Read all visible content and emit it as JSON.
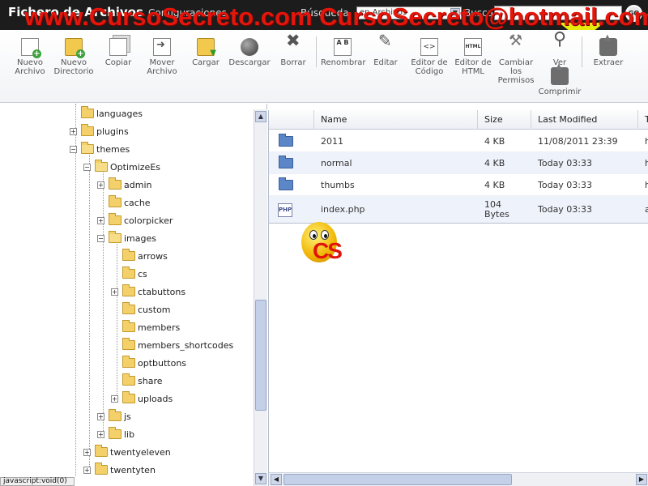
{
  "header": {
    "title": "Fichero de Archivos",
    "menu_config": "Configuraciones",
    "search_label": "Búsqueda",
    "search_scope": "en Archivos",
    "search_in": "Buscar",
    "search_value": "",
    "go_label": "GO"
  },
  "watermark": "www.CursoSecreto.com CursoSecreto@hotmail.com",
  "toolbar": [
    {
      "id": "nuevo-archivo",
      "label": "Nuevo Archivo",
      "icon": "new-file-icon"
    },
    {
      "id": "nuevo-directorio",
      "label": "Nuevo Directorio",
      "icon": "new-folder-icon"
    },
    {
      "id": "copiar",
      "label": "Copiar",
      "icon": "copy-icon"
    },
    {
      "id": "mover-archivo",
      "label": "Mover Archivo",
      "icon": "move-icon"
    },
    {
      "id": "cargar",
      "label": "Cargar",
      "icon": "upload-icon"
    },
    {
      "id": "descargar",
      "label": "Descargar",
      "icon": "download-icon"
    },
    {
      "id": "borrar",
      "label": "Borrar",
      "icon": "delete-icon"
    },
    {
      "id": "renombrar",
      "label": "Renombrar",
      "icon": "rename-icon"
    },
    {
      "id": "editar",
      "label": "Editar",
      "icon": "edit-icon"
    },
    {
      "id": "editor-codigo",
      "label": "Editor de Código",
      "icon": "code-editor-icon"
    },
    {
      "id": "editor-html",
      "label": "Editor de HTML",
      "icon": "html-editor-icon"
    },
    {
      "id": "cambiar-permisos",
      "label": "Cambiar los Permisos",
      "icon": "permissions-icon"
    },
    {
      "id": "ver",
      "label": "Ver",
      "icon": "view-icon"
    },
    {
      "id": "extraer",
      "label": "Extraer",
      "icon": "extract-icon"
    },
    {
      "id": "comprimir",
      "label": "Comprimir",
      "icon": "compress-icon"
    }
  ],
  "tree": [
    {
      "label": "languages",
      "expander": ""
    },
    {
      "label": "plugins",
      "expander": "+"
    },
    {
      "label": "themes",
      "expander": "−"
    },
    {
      "label": "OptimizeEs",
      "expander": "−"
    },
    {
      "label": "admin",
      "expander": "+"
    },
    {
      "label": "cache",
      "expander": ""
    },
    {
      "label": "colorpicker",
      "expander": "+"
    },
    {
      "label": "images",
      "expander": "−"
    },
    {
      "label": "arrows",
      "expander": ""
    },
    {
      "label": "cs",
      "expander": ""
    },
    {
      "label": "ctabuttons",
      "expander": "+"
    },
    {
      "label": "custom",
      "expander": ""
    },
    {
      "label": "members",
      "expander": ""
    },
    {
      "label": "members_shortcodes",
      "expander": ""
    },
    {
      "label": "optbuttons",
      "expander": ""
    },
    {
      "label": "share",
      "expander": ""
    },
    {
      "label": "uploads",
      "expander": "+"
    },
    {
      "label": "js",
      "expander": "+"
    },
    {
      "label": "lib",
      "expander": "+"
    },
    {
      "label": "twentyeleven",
      "expander": "+"
    },
    {
      "label": "twentyten",
      "expander": "+"
    }
  ],
  "status_text": "javascript:void(0)",
  "file_columns": [
    "Name",
    "Size",
    "Last Modified",
    "T"
  ],
  "files": [
    {
      "type": "folder",
      "name": "2011",
      "size": "4 KB",
      "modified": "11/08/2011 23:39",
      "t": "h"
    },
    {
      "type": "folder",
      "name": "normal",
      "size": "4 KB",
      "modified": "Today 03:33",
      "t": "h"
    },
    {
      "type": "folder",
      "name": "thumbs",
      "size": "4 KB",
      "modified": "Today 03:33",
      "t": "h"
    },
    {
      "type": "php",
      "name": "index.php",
      "size": "104 Bytes",
      "modified": "Today 03:33",
      "t": "a"
    }
  ],
  "mascot_text": "CS",
  "php_icon_text": "PHP",
  "colors": {
    "header_bg": "#1c1c1c",
    "watermark": "#e3160b",
    "folder_blue": "#5b86c8",
    "tree_folder": "#f3d06a"
  }
}
